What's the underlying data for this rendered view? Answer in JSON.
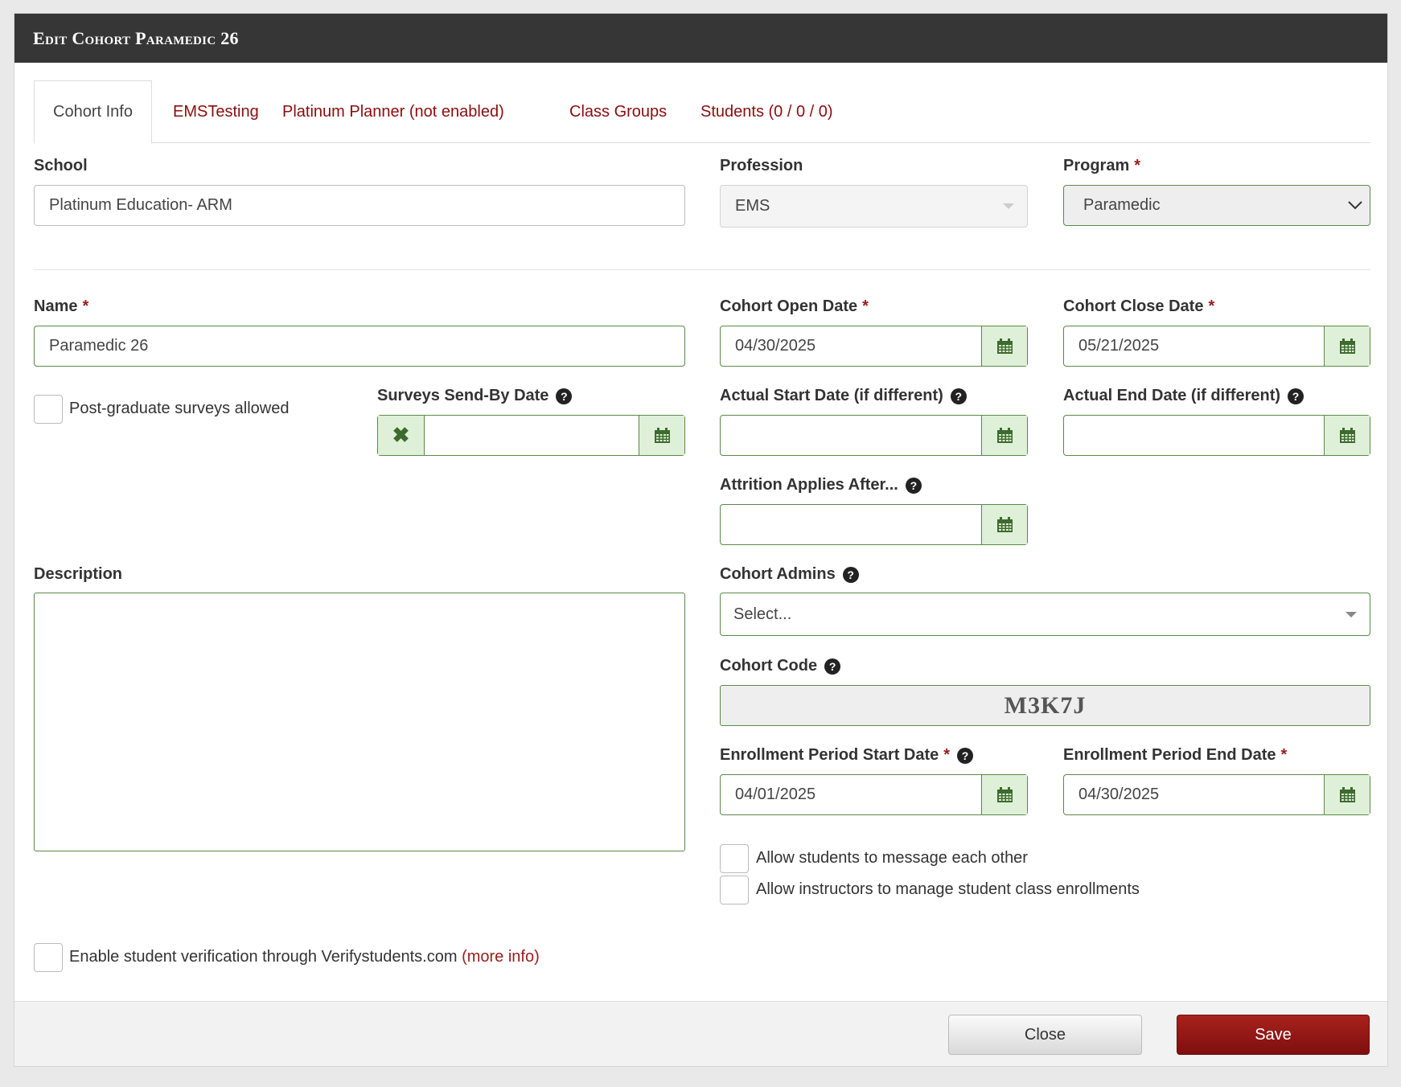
{
  "modal": {
    "title": "Edit Cohort Paramedic 26"
  },
  "tabs": [
    {
      "label": "Cohort Info"
    },
    {
      "label": "EMSTesting"
    },
    {
      "label": "Platinum Planner (not enabled)"
    },
    {
      "label": "Class Groups"
    },
    {
      "label": "Students (0 / 0 / 0)"
    }
  ],
  "school": {
    "label": "School",
    "value": "Platinum Education- ARM"
  },
  "profession": {
    "label": "Profession",
    "value": "EMS"
  },
  "program": {
    "label": "Program",
    "value": "Paramedic"
  },
  "name": {
    "label": "Name",
    "value": "Paramedic 26"
  },
  "cohort_open_date": {
    "label": "Cohort Open Date",
    "value": "04/30/2025"
  },
  "cohort_close_date": {
    "label": "Cohort Close Date",
    "value": "05/21/2025"
  },
  "post_grad_surveys": {
    "label": "Post-graduate surveys allowed"
  },
  "surveys_send_by": {
    "label": "Surveys Send-By Date",
    "value": ""
  },
  "actual_start": {
    "label": "Actual Start Date (if different)",
    "value": ""
  },
  "actual_end": {
    "label": "Actual End Date (if different)",
    "value": ""
  },
  "attrition": {
    "label": "Attrition Applies After...",
    "value": ""
  },
  "description": {
    "label": "Description"
  },
  "cohort_admins": {
    "label": "Cohort Admins",
    "placeholder": "Select..."
  },
  "cohort_code": {
    "label": "Cohort Code",
    "value": "M3K7J"
  },
  "enroll_start": {
    "label": "Enrollment Period Start Date",
    "value": "04/01/2025"
  },
  "enroll_end": {
    "label": "Enrollment Period End Date",
    "value": "04/30/2025"
  },
  "allow_messaging": {
    "label": "Allow students to message each other"
  },
  "allow_instructors": {
    "label": "Allow instructors to manage student class enrollments"
  },
  "verify": {
    "label": "Enable student verification through Verifystudents.com",
    "link": "(more info)"
  },
  "required_mark": "*",
  "help_glyph": "?",
  "footer": {
    "close_label": "Close",
    "save_label": "Save"
  },
  "colors": {
    "accent": "#8b0d0d",
    "header_bg": "#363636",
    "success_border": "#5a8a48",
    "addon_bg": "#dff0d8"
  }
}
